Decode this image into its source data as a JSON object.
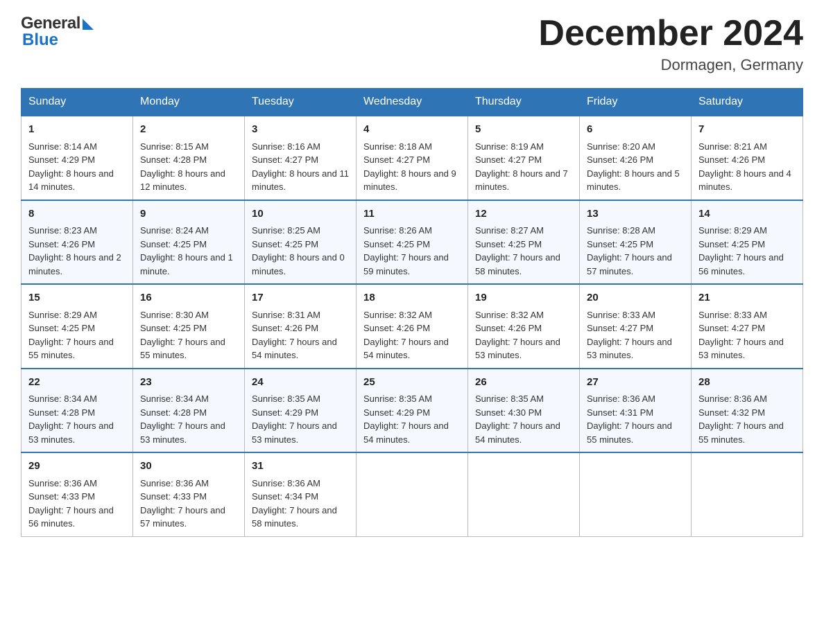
{
  "header": {
    "logo_general": "General",
    "logo_blue": "Blue",
    "month_title": "December 2024",
    "subtitle": "Dormagen, Germany"
  },
  "days_of_week": [
    "Sunday",
    "Monday",
    "Tuesday",
    "Wednesday",
    "Thursday",
    "Friday",
    "Saturday"
  ],
  "weeks": [
    [
      {
        "day": "1",
        "sunrise": "8:14 AM",
        "sunset": "4:29 PM",
        "daylight": "8 hours and 14 minutes."
      },
      {
        "day": "2",
        "sunrise": "8:15 AM",
        "sunset": "4:28 PM",
        "daylight": "8 hours and 12 minutes."
      },
      {
        "day": "3",
        "sunrise": "8:16 AM",
        "sunset": "4:27 PM",
        "daylight": "8 hours and 11 minutes."
      },
      {
        "day": "4",
        "sunrise": "8:18 AM",
        "sunset": "4:27 PM",
        "daylight": "8 hours and 9 minutes."
      },
      {
        "day": "5",
        "sunrise": "8:19 AM",
        "sunset": "4:27 PM",
        "daylight": "8 hours and 7 minutes."
      },
      {
        "day": "6",
        "sunrise": "8:20 AM",
        "sunset": "4:26 PM",
        "daylight": "8 hours and 5 minutes."
      },
      {
        "day": "7",
        "sunrise": "8:21 AM",
        "sunset": "4:26 PM",
        "daylight": "8 hours and 4 minutes."
      }
    ],
    [
      {
        "day": "8",
        "sunrise": "8:23 AM",
        "sunset": "4:26 PM",
        "daylight": "8 hours and 2 minutes."
      },
      {
        "day": "9",
        "sunrise": "8:24 AM",
        "sunset": "4:25 PM",
        "daylight": "8 hours and 1 minute."
      },
      {
        "day": "10",
        "sunrise": "8:25 AM",
        "sunset": "4:25 PM",
        "daylight": "8 hours and 0 minutes."
      },
      {
        "day": "11",
        "sunrise": "8:26 AM",
        "sunset": "4:25 PM",
        "daylight": "7 hours and 59 minutes."
      },
      {
        "day": "12",
        "sunrise": "8:27 AM",
        "sunset": "4:25 PM",
        "daylight": "7 hours and 58 minutes."
      },
      {
        "day": "13",
        "sunrise": "8:28 AM",
        "sunset": "4:25 PM",
        "daylight": "7 hours and 57 minutes."
      },
      {
        "day": "14",
        "sunrise": "8:29 AM",
        "sunset": "4:25 PM",
        "daylight": "7 hours and 56 minutes."
      }
    ],
    [
      {
        "day": "15",
        "sunrise": "8:29 AM",
        "sunset": "4:25 PM",
        "daylight": "7 hours and 55 minutes."
      },
      {
        "day": "16",
        "sunrise": "8:30 AM",
        "sunset": "4:25 PM",
        "daylight": "7 hours and 55 minutes."
      },
      {
        "day": "17",
        "sunrise": "8:31 AM",
        "sunset": "4:26 PM",
        "daylight": "7 hours and 54 minutes."
      },
      {
        "day": "18",
        "sunrise": "8:32 AM",
        "sunset": "4:26 PM",
        "daylight": "7 hours and 54 minutes."
      },
      {
        "day": "19",
        "sunrise": "8:32 AM",
        "sunset": "4:26 PM",
        "daylight": "7 hours and 53 minutes."
      },
      {
        "day": "20",
        "sunrise": "8:33 AM",
        "sunset": "4:27 PM",
        "daylight": "7 hours and 53 minutes."
      },
      {
        "day": "21",
        "sunrise": "8:33 AM",
        "sunset": "4:27 PM",
        "daylight": "7 hours and 53 minutes."
      }
    ],
    [
      {
        "day": "22",
        "sunrise": "8:34 AM",
        "sunset": "4:28 PM",
        "daylight": "7 hours and 53 minutes."
      },
      {
        "day": "23",
        "sunrise": "8:34 AM",
        "sunset": "4:28 PM",
        "daylight": "7 hours and 53 minutes."
      },
      {
        "day": "24",
        "sunrise": "8:35 AM",
        "sunset": "4:29 PM",
        "daylight": "7 hours and 53 minutes."
      },
      {
        "day": "25",
        "sunrise": "8:35 AM",
        "sunset": "4:29 PM",
        "daylight": "7 hours and 54 minutes."
      },
      {
        "day": "26",
        "sunrise": "8:35 AM",
        "sunset": "4:30 PM",
        "daylight": "7 hours and 54 minutes."
      },
      {
        "day": "27",
        "sunrise": "8:36 AM",
        "sunset": "4:31 PM",
        "daylight": "7 hours and 55 minutes."
      },
      {
        "day": "28",
        "sunrise": "8:36 AM",
        "sunset": "4:32 PM",
        "daylight": "7 hours and 55 minutes."
      }
    ],
    [
      {
        "day": "29",
        "sunrise": "8:36 AM",
        "sunset": "4:33 PM",
        "daylight": "7 hours and 56 minutes."
      },
      {
        "day": "30",
        "sunrise": "8:36 AM",
        "sunset": "4:33 PM",
        "daylight": "7 hours and 57 minutes."
      },
      {
        "day": "31",
        "sunrise": "8:36 AM",
        "sunset": "4:34 PM",
        "daylight": "7 hours and 58 minutes."
      },
      null,
      null,
      null,
      null
    ]
  ]
}
